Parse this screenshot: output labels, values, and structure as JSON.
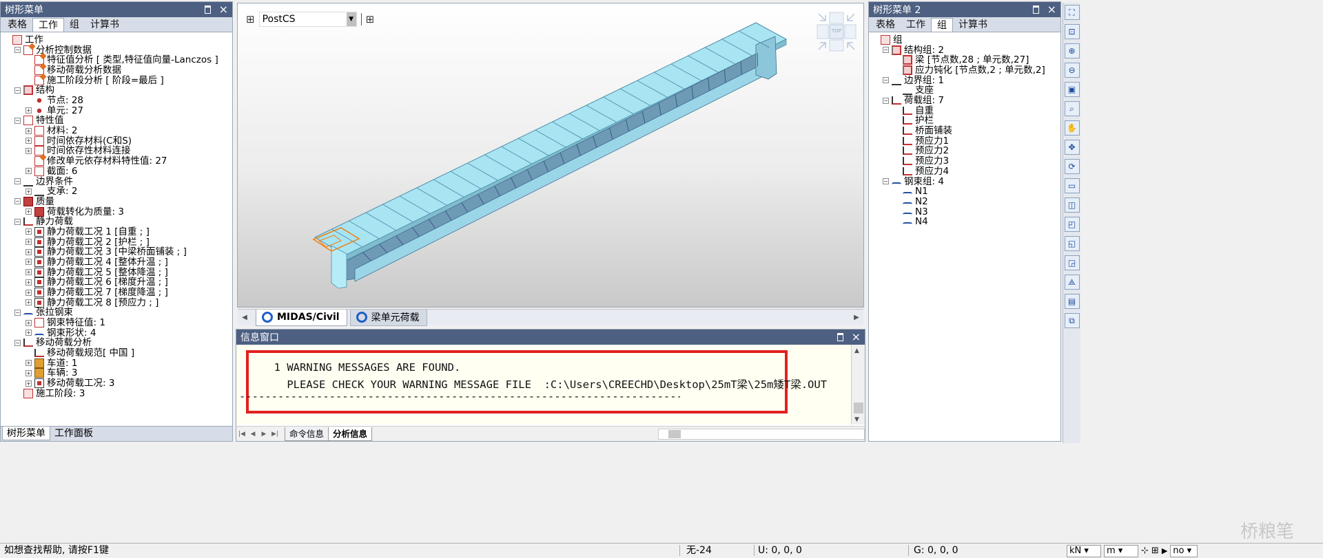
{
  "left_panel": {
    "title": "树形菜单",
    "tabs": [
      "表格",
      "工作",
      "组",
      "计算书"
    ],
    "active_tab": 1,
    "tree": [
      {
        "label": "工作",
        "level": 0,
        "exp": "",
        "icon": "work-icon"
      },
      {
        "label": "分析控制数据",
        "level": 1,
        "exp": "-",
        "icon": "analysis-control-icon"
      },
      {
        "label": "特征值分析 [ 类型,特征值向量-Lanczos ]",
        "level": 2,
        "exp": "",
        "icon": "eigen-analysis-icon"
      },
      {
        "label": "移动荷载分析数据",
        "level": 2,
        "exp": "",
        "icon": "moving-load-data-icon"
      },
      {
        "label": "施工阶段分析 [ 阶段=最后 ]",
        "level": 2,
        "exp": "",
        "icon": "construction-stage-analysis-icon"
      },
      {
        "label": "结构",
        "level": 1,
        "exp": "-",
        "icon": "structure-icon"
      },
      {
        "label": "节点: 28",
        "level": 2,
        "exp": "",
        "icon": "node-icon"
      },
      {
        "label": "单元: 27",
        "level": 2,
        "exp": "+",
        "icon": "element-icon"
      },
      {
        "label": "特性值",
        "level": 1,
        "exp": "-",
        "icon": "property-icon"
      },
      {
        "label": "材料: 2",
        "level": 2,
        "exp": "+",
        "icon": "material-icon"
      },
      {
        "label": "时间依存材料(C和S)",
        "level": 2,
        "exp": "+",
        "icon": "time-material-icon"
      },
      {
        "label": "时间依存性材料连接",
        "level": 2,
        "exp": "+",
        "icon": "time-link-icon"
      },
      {
        "label": "修改单元依存材料特性值: 27",
        "level": 2,
        "exp": "",
        "icon": "modify-material-icon"
      },
      {
        "label": "截面: 6",
        "level": 2,
        "exp": "+",
        "icon": "section-icon"
      },
      {
        "label": "边界条件",
        "level": 1,
        "exp": "-",
        "icon": "boundary-icon"
      },
      {
        "label": "支承: 2",
        "level": 2,
        "exp": "+",
        "icon": "support-icon"
      },
      {
        "label": "质量",
        "level": 1,
        "exp": "-",
        "icon": "mass-icon"
      },
      {
        "label": "荷载转化为质量: 3",
        "level": 2,
        "exp": "+",
        "icon": "load-to-mass-icon"
      },
      {
        "label": "静力荷载",
        "level": 1,
        "exp": "-",
        "icon": "static-load-icon"
      },
      {
        "label": "静力荷载工况 1 [自重 ; ]",
        "level": 2,
        "exp": "+",
        "icon": "load-case-icon"
      },
      {
        "label": "静力荷载工况 2 [护栏 ; ]",
        "level": 2,
        "exp": "+",
        "icon": "load-case-icon"
      },
      {
        "label": "静力荷载工况 3 [中梁桥面铺装 ; ]",
        "level": 2,
        "exp": "+",
        "icon": "load-case-icon"
      },
      {
        "label": "静力荷载工况 4 [整体升温 ; ]",
        "level": 2,
        "exp": "+",
        "icon": "load-case-icon"
      },
      {
        "label": "静力荷载工况 5 [整体降温 ; ]",
        "level": 2,
        "exp": "+",
        "icon": "load-case-icon"
      },
      {
        "label": "静力荷载工况 6 [梯度升温 ; ]",
        "level": 2,
        "exp": "+",
        "icon": "load-case-icon"
      },
      {
        "label": "静力荷载工况 7 [梯度降温 ; ]",
        "level": 2,
        "exp": "+",
        "icon": "load-case-icon"
      },
      {
        "label": "静力荷载工况 8 [预应力 ; ]",
        "level": 2,
        "exp": "+",
        "icon": "load-case-icon"
      },
      {
        "label": "张拉钢束",
        "level": 1,
        "exp": "-",
        "icon": "tendon-icon"
      },
      {
        "label": "钢束特征值: 1",
        "level": 2,
        "exp": "+",
        "icon": "tendon-property-icon"
      },
      {
        "label": "钢束形状: 4",
        "level": 2,
        "exp": "+",
        "icon": "tendon-profile-icon"
      },
      {
        "label": "移动荷载分析",
        "level": 1,
        "exp": "-",
        "icon": "moving-load-icon"
      },
      {
        "label": "移动荷载规范[ 中国 ]",
        "level": 2,
        "exp": "",
        "icon": "moving-load-code-icon"
      },
      {
        "label": "车道: 1",
        "level": 2,
        "exp": "+",
        "icon": "lane-icon"
      },
      {
        "label": "车辆: 3",
        "level": 2,
        "exp": "+",
        "icon": "vehicle-icon"
      },
      {
        "label": "移动荷载工况: 3",
        "level": 2,
        "exp": "+",
        "icon": "moving-load-case-icon"
      },
      {
        "label": "施工阶段: 3",
        "level": 1,
        "exp": "",
        "icon": "construction-stage-icon"
      }
    ],
    "bottom_tabs": [
      "树形菜单",
      "工作面板"
    ]
  },
  "view": {
    "coord_system": "PostCS",
    "tabs": [
      "MIDAS/Civil",
      "梁单元荷载"
    ],
    "active_tab": 0,
    "view_cube_label": "TOP"
  },
  "message_window": {
    "title": "信息窗口",
    "lines": [
      "  1 WARNING MESSAGES ARE FOUND.",
      "    PLEASE CHECK YOUR WARNING MESSAGE FILE  :C:\\Users\\CREECHD\\Desktop\\25mT梁\\25m矮T梁.OUT",
      "------------------------------------------------------------------------------------"
    ],
    "tabs": [
      "命令信息",
      "分析信息"
    ],
    "active_tab": 1
  },
  "right_panel": {
    "title": "树形菜单 2",
    "tabs": [
      "表格",
      "工作",
      "组",
      "计算书"
    ],
    "active_tab": 2,
    "tree": [
      {
        "label": "组",
        "level": 0,
        "exp": "",
        "icon": "group-icon"
      },
      {
        "label": "结构组: 2",
        "level": 1,
        "exp": "-",
        "icon": "structure-group-icon"
      },
      {
        "label": "梁 [节点数,28 ; 单元数,27]",
        "level": 2,
        "exp": "",
        "icon": "beam-group-icon"
      },
      {
        "label": "应力钝化 [节点数,2 ; 单元数,2]",
        "level": 2,
        "exp": "",
        "icon": "stress-group-icon"
      },
      {
        "label": "边界组: 1",
        "level": 1,
        "exp": "-",
        "icon": "boundary-group-icon"
      },
      {
        "label": "支座",
        "level": 2,
        "exp": "",
        "icon": "bearing-icon"
      },
      {
        "label": "荷载组: 7",
        "level": 1,
        "exp": "-",
        "icon": "load-group-icon"
      },
      {
        "label": "自重",
        "level": 2,
        "exp": "",
        "icon": "load-item-icon"
      },
      {
        "label": "护栏",
        "level": 2,
        "exp": "",
        "icon": "load-item-icon"
      },
      {
        "label": "桥面铺装",
        "level": 2,
        "exp": "",
        "icon": "load-item-icon"
      },
      {
        "label": "预应力1",
        "level": 2,
        "exp": "",
        "icon": "load-item-icon"
      },
      {
        "label": "预应力2",
        "level": 2,
        "exp": "",
        "icon": "load-item-icon"
      },
      {
        "label": "预应力3",
        "level": 2,
        "exp": "",
        "icon": "load-item-icon"
      },
      {
        "label": "预应力4",
        "level": 2,
        "exp": "",
        "icon": "load-item-icon"
      },
      {
        "label": "钢束组: 4",
        "level": 1,
        "exp": "-",
        "icon": "tendon-group-icon"
      },
      {
        "label": "N1",
        "level": 2,
        "exp": "",
        "icon": "tendon-item-icon"
      },
      {
        "label": "N2",
        "level": 2,
        "exp": "",
        "icon": "tendon-item-icon"
      },
      {
        "label": "N3",
        "level": 2,
        "exp": "",
        "icon": "tendon-item-icon"
      },
      {
        "label": "N4",
        "level": 2,
        "exp": "",
        "icon": "tendon-item-icon"
      }
    ]
  },
  "status_bar": {
    "help": "如想查找帮助, 请按F1键",
    "selection": "无-24",
    "u_coord": "U: 0, 0, 0",
    "g_coord": "G: 0, 0, 0",
    "force_unit": "kN",
    "length_unit": "m",
    "mode": "no"
  },
  "watermark": "桥粮笔",
  "colors": {
    "title_bar": "#4d6082",
    "beam_top": "#a8e4f2",
    "beam_web": "#6f9ab6",
    "warning_frame": "#e02020"
  }
}
